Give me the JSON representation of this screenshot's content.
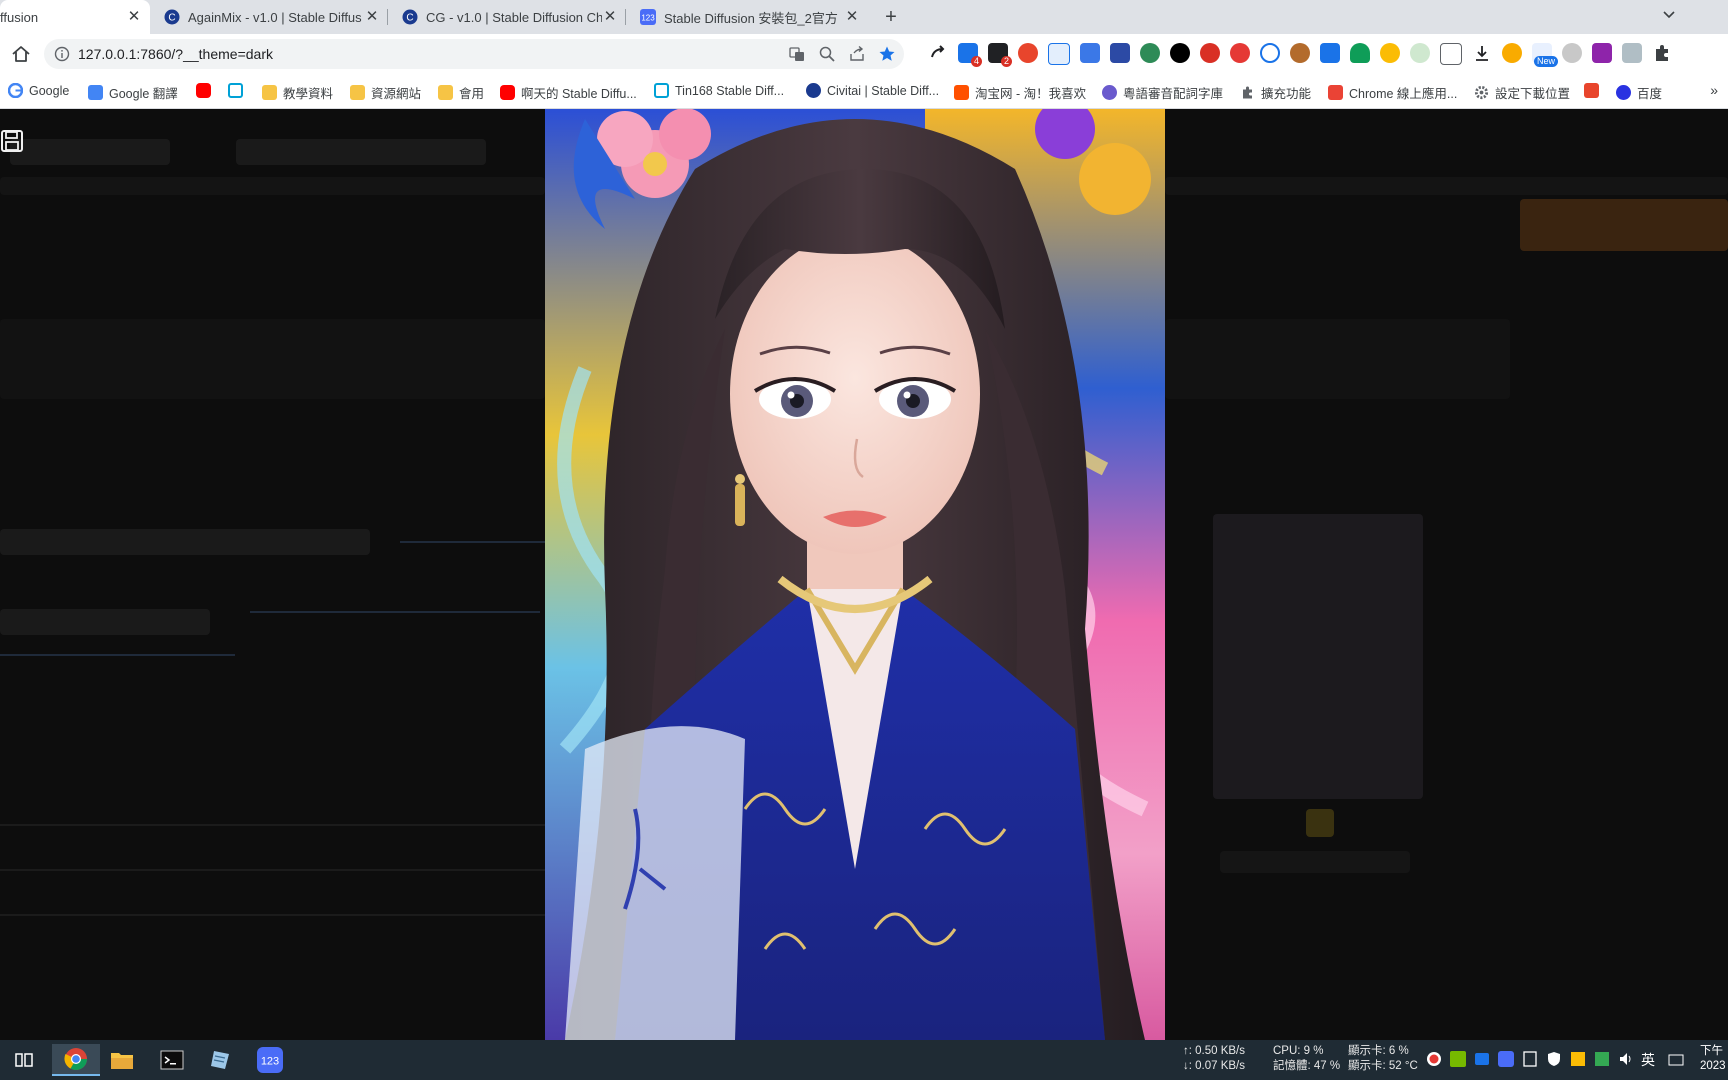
{
  "browser": {
    "tabs": [
      {
        "title": "ffusion",
        "active": true
      },
      {
        "title": "AgainMix - v1.0 | Stable Diffus",
        "active": false
      },
      {
        "title": "CG - v1.0 | Stable Diffusion Ch",
        "active": false
      },
      {
        "title": "Stable Diffusion 安裝包_2官方",
        "active": false
      }
    ],
    "new_tab_label": "+",
    "address": "127.0.0.1:7860/?__theme=dark"
  },
  "bookmarks": [
    {
      "label": "Google",
      "color": "#4285f4"
    },
    {
      "label": "Google 翻譯",
      "color": "#4285f4"
    },
    {
      "label": "",
      "color": "#ff0000"
    },
    {
      "label": "",
      "color": "#00a1d6"
    },
    {
      "label": "教學資料",
      "color": "#f6c445"
    },
    {
      "label": "資源網站",
      "color": "#f6c445"
    },
    {
      "label": "會用",
      "color": "#f6c445"
    },
    {
      "label": "啊天的 Stable Diffu...",
      "color": "#ff0000"
    },
    {
      "label": "Tin168 Stable Diff...",
      "color": "#00a1d6"
    },
    {
      "label": "Civitai | Stable Diff...",
      "color": "#1a3a8f"
    },
    {
      "label": "淘宝网 - 淘！我喜欢",
      "color": "#ff5000"
    },
    {
      "label": "粵語審音配詞字庫",
      "color": "#6a5acd"
    },
    {
      "label": "擴充功能",
      "color": "#5f6368"
    },
    {
      "label": "Chrome 線上應用...",
      "color": "#ea4335"
    },
    {
      "label": "設定下載位置",
      "color": "#5f6368"
    },
    {
      "label": "",
      "color": "#e8452c"
    },
    {
      "label": "百度",
      "color": "#2932e1"
    }
  ],
  "taskbar": {
    "net_up": "↑: 0.50 KB/s",
    "net_down": "↓: 0.07 KB/s",
    "cpu": "CPU: 9 %",
    "memory": "記憶體: 47 %",
    "gpu_load": "顯示卡: 6 %",
    "gpu_temp": "顯示卡: 52 °C",
    "ime": "英",
    "clock_line1": "下午",
    "clock_line2": "2023"
  },
  "extension_badges": {
    "b1": "4",
    "b2": "2",
    "new": "New"
  }
}
